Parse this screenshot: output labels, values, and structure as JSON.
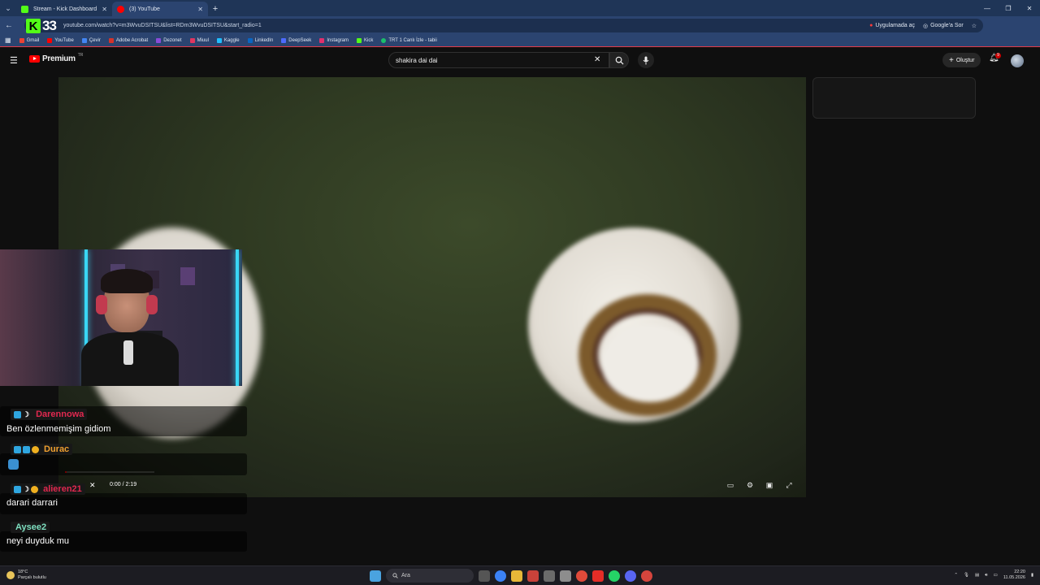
{
  "browser": {
    "tabs": [
      {
        "label": "Stream - Kick Dashboard",
        "active": false,
        "favicon_color": "#53fc18"
      },
      {
        "label": "(3) YouTube",
        "active": true,
        "favicon_color": "#ff0000"
      }
    ],
    "url": "youtube.com/watch?v=m3WvuDSITSU&list=RDm3WvuDSITSU&start_radio=1",
    "open_in_app": "Uygulamada aç",
    "ask_google": "Google'a Sor",
    "overlay_logo": {
      "letter": "K",
      "number": "33"
    },
    "bookmarks": [
      {
        "label": "Gmail",
        "color": "#ea4335"
      },
      {
        "label": "YouTube",
        "color": "#ff0000"
      },
      {
        "label": "Çevir",
        "color": "#4285f4"
      },
      {
        "label": "Adobe Acrobat",
        "color": "#d4332b"
      },
      {
        "label": "Dezonet",
        "color": "#8a4bd8"
      },
      {
        "label": "Miuul",
        "color": "#e0365f"
      },
      {
        "label": "Kaggle",
        "color": "#20beff"
      },
      {
        "label": "LinkedIn",
        "color": "#0a66c2"
      },
      {
        "label": "DeepSeek",
        "color": "#4d6bfe"
      },
      {
        "label": "Instagram",
        "color": "#e1306c"
      },
      {
        "label": "Kick",
        "color": "#53fc18"
      },
      {
        "label": "TRT 1 Canlı İzle - tabii",
        "color": "#1bbf6b"
      }
    ]
  },
  "youtube": {
    "brand": "Premium",
    "trademark": "TR",
    "search_query": "shakira dai dai",
    "create_label": "Oluştur",
    "notification_count": "9",
    "player": {
      "time": "0:00 / 2:19",
      "progress": 0.0
    }
  },
  "chat": {
    "messages": [
      {
        "user": "Darennowa",
        "user_color": "#e0284f",
        "text": "Ben özlenmemişim gidiom"
      },
      {
        "user": "Durac",
        "user_color": "#f0a030",
        "text": ""
      },
      {
        "user": "alieren21",
        "user_color": "#e0284f",
        "text": "darari darrari"
      },
      {
        "user": "Aysee2",
        "user_color": "#7ee0c0",
        "text": "neyi duyduk mu"
      }
    ]
  },
  "taskbar": {
    "weather_temp": "18°C",
    "weather_desc": "Parçalı bulutlu",
    "search_placeholder": "Ara",
    "time": "22:20",
    "date": "11.05.2026"
  }
}
